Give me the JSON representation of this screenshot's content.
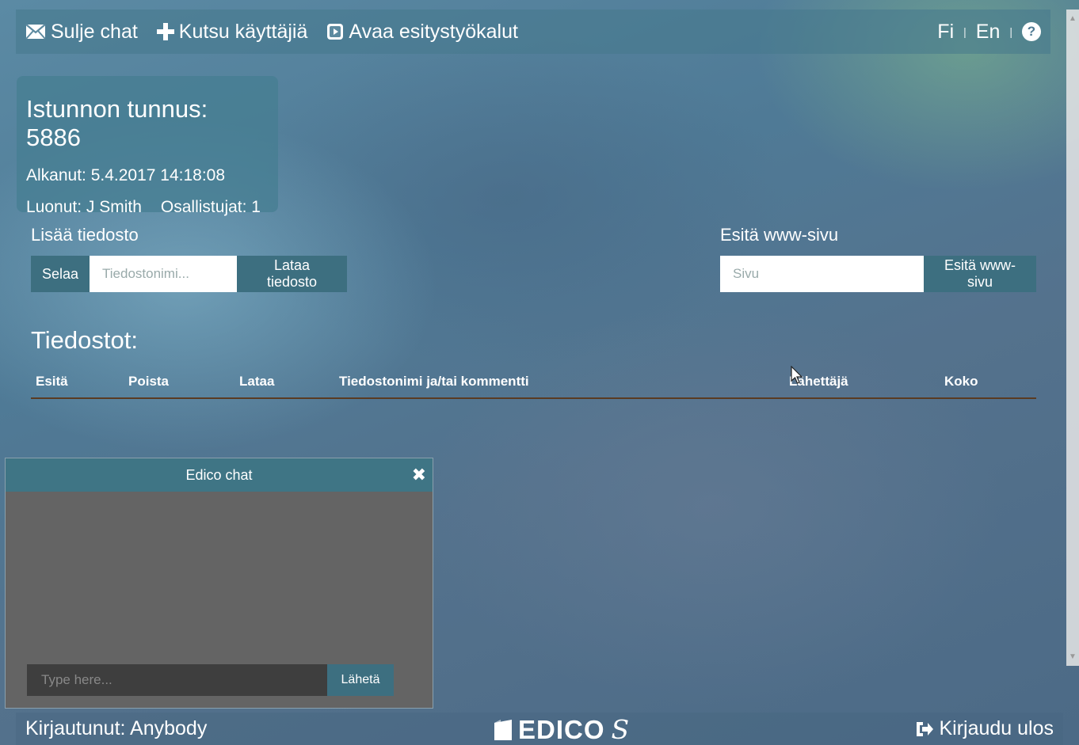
{
  "nav": {
    "close_chat": "Sulje chat",
    "invite_users": "Kutsu käyttäjiä",
    "open_presentation_tools": "Avaa esitystyökalut",
    "lang_fi": "Fi",
    "lang_en": "En",
    "separator": "|"
  },
  "session": {
    "title": "Istunnon tunnus: 5886",
    "started": "Alkanut: 5.4.2017 14:18:08",
    "created_by": "Luonut: J Smith",
    "participants": "Osallistujat: 1"
  },
  "upload": {
    "label": "Lisää tiedosto",
    "browse_label": "Selaa",
    "filename_placeholder": "Tiedostonimi...",
    "upload_label": "Lataa tiedosto"
  },
  "webpage": {
    "label": "Esitä www-sivu",
    "url_placeholder": "Sivu",
    "present_label": "Esitä www-sivu"
  },
  "files": {
    "heading": "Tiedostot:",
    "columns": [
      "Esitä",
      "Poista",
      "Lataa",
      "Tiedostonimi ja/tai kommentti",
      "Lähettäjä",
      "Koko"
    ]
  },
  "chat": {
    "title": "Edico chat",
    "close_symbol": "✖",
    "input_placeholder": "Type here...",
    "send_label": "Lähetä"
  },
  "footer": {
    "logged_in": "Kirjautunut: Anybody",
    "brand": "EDICO",
    "brand_suffix": "S",
    "logout": "Kirjaudu ulos"
  },
  "icons": {
    "close_chat": "envelope-icon",
    "invite": "plus-icon",
    "presentation": "play-square-icon",
    "help": "question-circle-icon",
    "logout": "sign-out-icon",
    "brand": "edico-logo-icon"
  },
  "colors": {
    "button_teal": "#3d6f80",
    "chat_header": "#3f7585",
    "chat_body": "#646464",
    "table_rule": "#5a3b22"
  }
}
